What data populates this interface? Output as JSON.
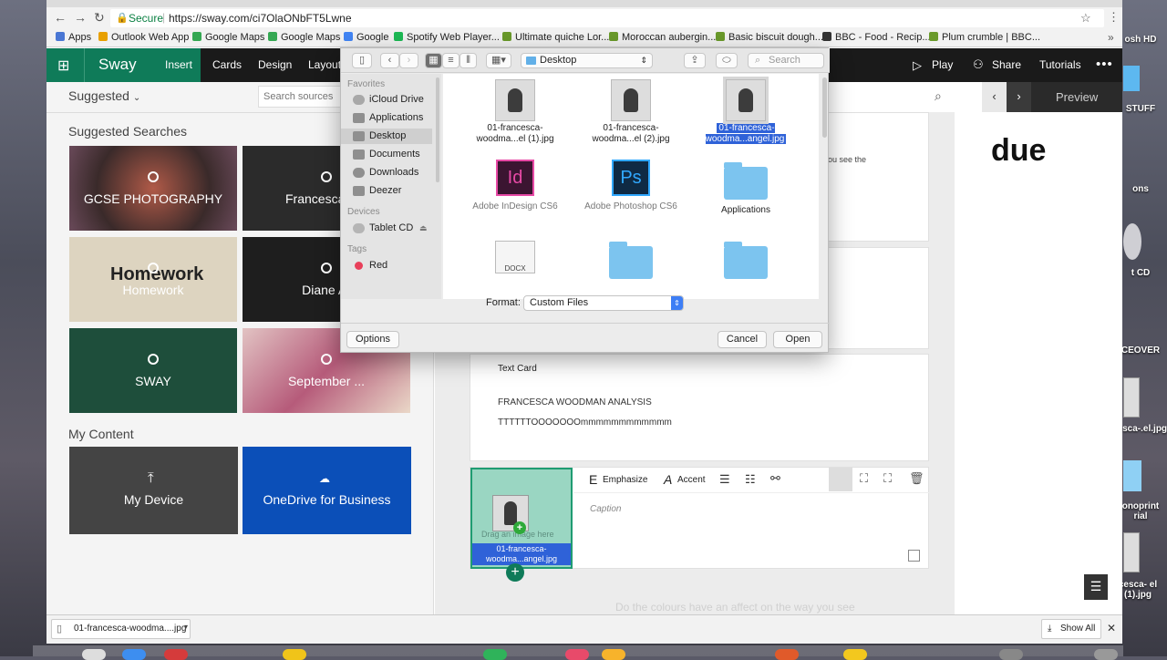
{
  "url": {
    "secure": "Secure",
    "address": "https://sway.com/ci7OlaONbFT5Lwne"
  },
  "bookmarks": [
    {
      "label": "Apps",
      "color": "#4a77d4"
    },
    {
      "label": "Outlook Web App",
      "color": "#e8a000"
    },
    {
      "label": "Google Maps",
      "color": "#35a853"
    },
    {
      "label": "Google Maps",
      "color": "#35a853"
    },
    {
      "label": "Google",
      "color": "#4285f4"
    },
    {
      "label": "Spotify Web Player...",
      "color": "#1db954"
    },
    {
      "label": "Ultimate quiche Lor...",
      "color": "#6a9a2b"
    },
    {
      "label": "Moroccan aubergin...",
      "color": "#6a9a2b"
    },
    {
      "label": "Basic biscuit dough...",
      "color": "#6a9a2b"
    },
    {
      "label": "BBC - Food - Recip...",
      "color": "#333333"
    },
    {
      "label": "Plum crumble | BBC...",
      "color": "#6a9a2b"
    }
  ],
  "sway": {
    "brand": "Sway",
    "tabs": [
      "Insert",
      "Cards",
      "Design",
      "Layout"
    ],
    "right": {
      "play": "Play",
      "share": "Share",
      "tutorials": "Tutorials"
    },
    "accent": "#0f7b59"
  },
  "left": {
    "filter": "Suggested",
    "search_placeholder": "Search sources",
    "suggested_heading": "Suggested Searches",
    "tiles": [
      "GCSE PHOTOGRAPHY",
      "Francesca Wo",
      "Homework",
      "Diane Ar",
      "SWAY",
      "September ..."
    ],
    "my_content_heading": "My Content",
    "my_device": "My Device",
    "onedrive": "OneDrive for Business"
  },
  "center": {
    "peek_text": "ou see the",
    "card_label": "Text Card",
    "heading": "FRANCESCA WOODMAN ANALYSIS",
    "body": "TTTTTTOOOOOOOmmmmmmmmmmmm",
    "toolbar": {
      "emphasize": "Emphasize",
      "accent": "Accent"
    },
    "caption_placeholder": "Caption",
    "drop_hint": "Drag an image here",
    "drag_file": "01-francesca-woodma...angel.jpg",
    "bottom_text": "Do the colours have an affect on the way you see"
  },
  "preview": {
    "label": "Preview",
    "title": "due"
  },
  "dialog": {
    "location": "Desktop",
    "search_placeholder": "Search",
    "favorites_heading": "Favorites",
    "favorites": [
      "iCloud Drive",
      "Applications",
      "Desktop",
      "Documents",
      "Downloads",
      "Deezer"
    ],
    "devices_heading": "Devices",
    "devices": [
      "Tablet CD"
    ],
    "tags_heading": "Tags",
    "tags": [
      "Red"
    ],
    "files": [
      {
        "name": "01-francesca-woodma...el (1).jpg",
        "kind": "photo"
      },
      {
        "name": "01-francesca-woodma...el (2).jpg",
        "kind": "photo"
      },
      {
        "name": "01-francesca-woodma...angel.jpg",
        "kind": "photo",
        "selected": true
      },
      {
        "name": "Adobe InDesign CS6",
        "kind": "indesign"
      },
      {
        "name": "Adobe Photoshop CS6",
        "kind": "photoshop"
      },
      {
        "name": "Applications",
        "kind": "folder"
      },
      {
        "name": "",
        "kind": "docx"
      },
      {
        "name": "",
        "kind": "folder"
      },
      {
        "name": "",
        "kind": "folder"
      }
    ],
    "format_label": "Format:",
    "format_value": "Custom Files",
    "options": "Options",
    "cancel": "Cancel",
    "open": "Open",
    "docx_label": "DOCX",
    "id_label": "Id",
    "ps_label": "Ps"
  },
  "download": {
    "file": "01-francesca-woodma....jpg",
    "show_all": "Show All"
  },
  "desktop_labels": [
    "osh HD",
    "STUFF",
    "ons",
    "t CD",
    "CEOVER",
    "cesca-.el.jpg",
    "onoprint rial",
    "cesca- el (1).jpg"
  ]
}
